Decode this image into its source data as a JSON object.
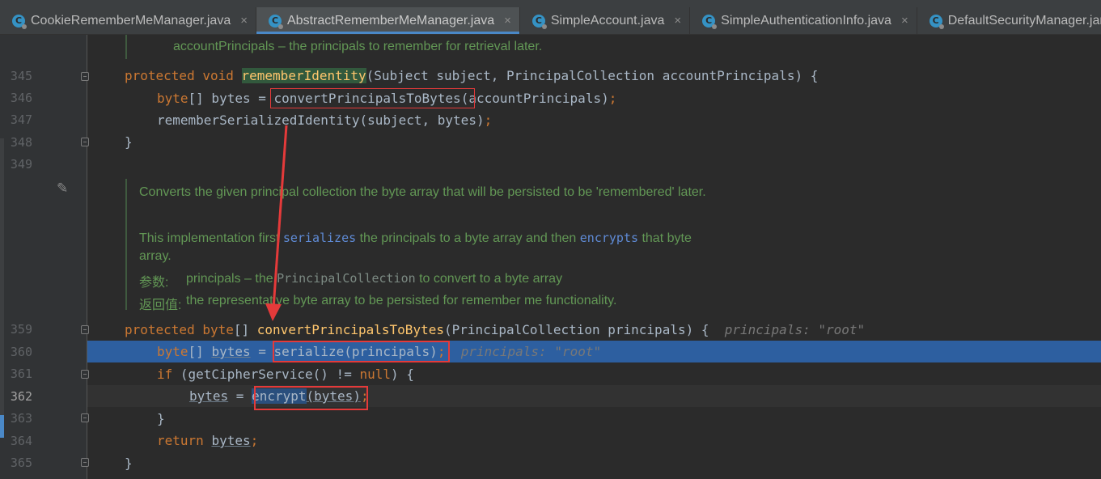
{
  "tabs": [
    {
      "label": "CookieRememberMeManager.java",
      "active": false
    },
    {
      "label": "AbstractRememberMeManager.java",
      "active": true
    },
    {
      "label": "SimpleAccount.java",
      "active": false
    },
    {
      "label": "SimpleAuthenticationInfo.java",
      "active": false
    },
    {
      "label": "DefaultSecurityManager.jar",
      "active": false
    }
  ],
  "tab_close_glyph": "×",
  "line_numbers": {
    "l345": "345",
    "l346": "346",
    "l347": "347",
    "l348": "348",
    "l349": "349",
    "l359": "359",
    "l360": "360",
    "l361": "361",
    "l362": "362",
    "l363": "363",
    "l364": "364",
    "l365": "365"
  },
  "doc_top": {
    "param_line": "accountPrincipals – the principals to remember for retrieval later."
  },
  "code": {
    "l345": {
      "protected": "protected",
      "void": "void",
      "method": "rememberIdentity",
      "params": "(Subject subject, PrincipalCollection accountPrincipals) {"
    },
    "l346": {
      "type": "byte",
      "rest": "[] bytes = ",
      "call": "convertPrincipalsToBytes",
      "args": "(accountPrincipals)",
      "semi": ";"
    },
    "l347": {
      "text": "rememberSerializedIdentity(subject, bytes)",
      "semi": ";"
    },
    "l348": {
      "text": "}"
    },
    "l359": {
      "protected": "protected",
      "type": "byte",
      "brackets": "[] ",
      "method": "convertPrincipalsToBytes",
      "params": "(PrincipalCollection principals) {",
      "hint": "principals: \"root\""
    },
    "l360": {
      "type": "byte",
      "brackets": "[] ",
      "var": "bytes",
      "eq": " = ",
      "call": "serialize(principals)",
      "semi": ";",
      "hint": "principals: \"root\""
    },
    "l361": {
      "kw_if": "if",
      "mid": " (getCipherService() != ",
      "null": "null",
      "end": ") {"
    },
    "l362": {
      "var": "bytes",
      "eq": " = ",
      "call": "encrypt",
      "args": "(bytes)",
      "semi": ";"
    },
    "l363": {
      "text": "}"
    },
    "l364": {
      "kw_return": "return",
      "var": "bytes",
      "semi": ";"
    },
    "l365": {
      "text": "}"
    }
  },
  "doc": {
    "line1": "Converts the given principal collection the byte array that will be persisted to be 'remembered' later.",
    "line2_a": "This implementation first ",
    "line2_code1": "serializes",
    "line2_b": " the principals to a byte array and then ",
    "line2_code2": "encrypts",
    "line2_c": " that byte",
    "line3": "array.",
    "param_label": "参数:",
    "param_a": "principals – the ",
    "param_code": "PrincipalCollection",
    "param_b": " to convert to a byte array",
    "return_label": "返回值:",
    "return_text": "the representative byte array to be persisted for remember me functionality."
  },
  "colors": {
    "annotation_red": "#e43a3a",
    "selection_blue": "#2d5fa0",
    "keyword_orange": "#cc7832",
    "method_yellow": "#ffc66d",
    "doc_green": "#629755"
  },
  "icons": {
    "tab_file_icon": "java-class-icon",
    "fold_marker": "fold-marker-icon",
    "edit_doc": "pencil-icon"
  }
}
